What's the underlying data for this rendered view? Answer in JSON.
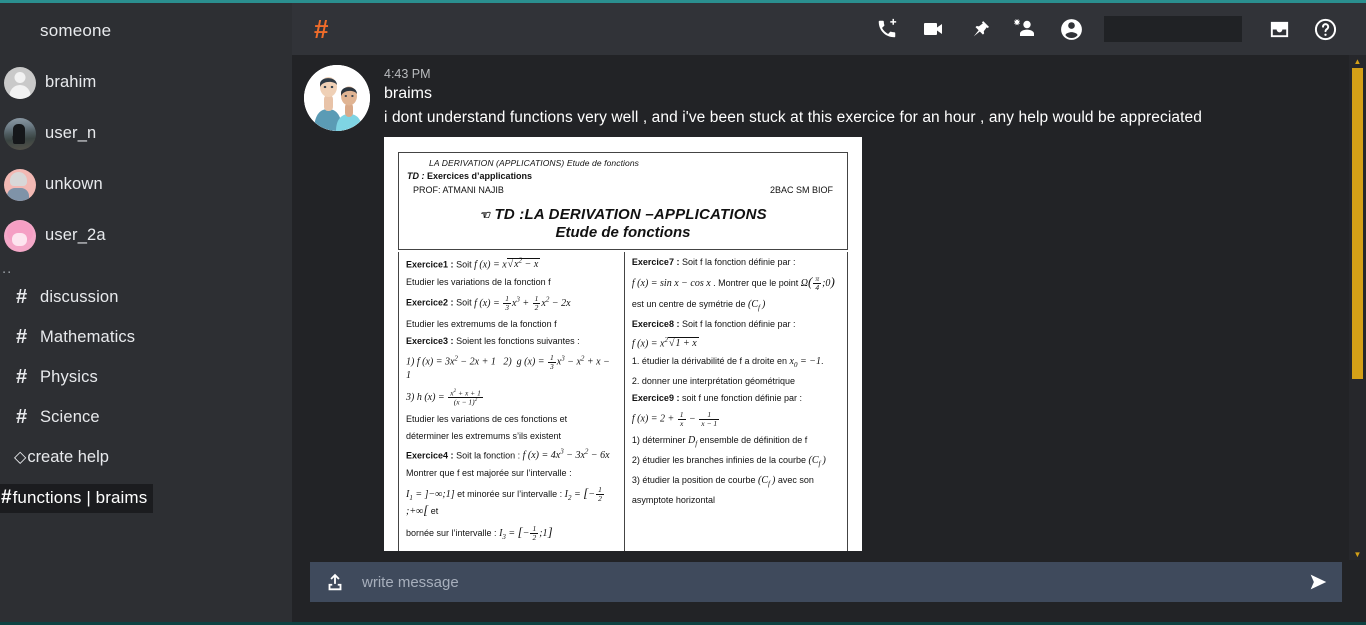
{
  "window": {
    "accent_top": "#2a8f8f",
    "accent_bottom": "#0e4242"
  },
  "sidebar": {
    "title": "someone",
    "dms": [
      {
        "name": "brahim",
        "avatar": "default-person-avatar"
      },
      {
        "name": "user_n",
        "avatar": "photo-avatar-dark"
      },
      {
        "name": "unkown",
        "avatar": "photo-avatar-pink"
      },
      {
        "name": "user_2a",
        "avatar": "photo-avatar-anime"
      }
    ],
    "divider_dots": "..",
    "channels": [
      {
        "hash": "#",
        "name": "discussion"
      },
      {
        "hash": "#",
        "name": "Mathematics"
      },
      {
        "hash": "#",
        "name": "Physics"
      },
      {
        "hash": "#",
        "name": "Science"
      }
    ],
    "create": {
      "icon": "pencil-icon",
      "glyph": "◇",
      "label": "create help"
    },
    "active_channel": {
      "hash": "#",
      "label": "functions | braims"
    }
  },
  "topbar": {
    "hash": "#",
    "hash_color": "#ef6c2a",
    "icons": [
      {
        "name": "add-call-icon",
        "label": "Add call"
      },
      {
        "name": "video-call-icon",
        "label": "Video call"
      },
      {
        "name": "pin-icon",
        "label": "Pinned messages"
      },
      {
        "name": "add-person-icon",
        "label": "Add member"
      },
      {
        "name": "account-circle-icon",
        "label": "Account"
      }
    ],
    "search": {
      "value": "",
      "placeholder": ""
    },
    "right_icons": [
      {
        "name": "inbox-icon",
        "label": "Inbox"
      },
      {
        "name": "help-icon",
        "label": "Help"
      }
    ]
  },
  "message": {
    "time": "4:43 PM",
    "author": "braims",
    "avatar": "couple-photo-avatar",
    "text": "i dont understand functions very well , and i've been stuck at this exercice for an hour , any help would be appreciated",
    "attachment": {
      "name": "derivation-worksheet-image",
      "doc": {
        "header_line1": "LA DERIVATION (APPLICATIONS)  Etude de fonctions",
        "header_line2_bold_italic": "TD :",
        "header_line2": "Exercices d’applications",
        "prof": "PROF: ATMANI NAJIB",
        "class": "2BAC SM BIOF",
        "title": "TD :LA DERIVATION –APPLICATIONS",
        "subtitle": "Etude de fonctions",
        "left_column": {
          "ex1_label": "Exercice1 :",
          "ex1_text": "Soit",
          "ex1_instr": "Etudier les variations de la fonction f",
          "ex2_label": "Exercice2 :",
          "ex2_text": "Soit",
          "ex2_instr": "Etudier les extremums de la fonction f",
          "ex3_label": "Exercice3 :",
          "ex3_text": "Soient les fonctions suivantes :",
          "ex3_instr_a": "Etudier les variations de ces fonctions et",
          "ex3_instr_b": "déterminer les extremums s’ils existent",
          "ex4_label": "Exercice4 :",
          "ex4_text": "Soit la fonction :",
          "ex4_instr": "Montrer que f est majorée sur l’intervalle :",
          "ex4_mid": "et minorée sur l’intervalle :",
          "ex4_and": "et",
          "ex4_end": "bornée sur l’intervalle :"
        },
        "right_column": {
          "ex7_label": "Exercice7 :",
          "ex7_text": "Soit f la fonction définie par :",
          "ex7_mid": ". Montrer que le point",
          "ex7_instr": "est un centre de symétrie  de",
          "ex8_label": "Exercice8 :",
          "ex8_text": "Soit f la fonction définie par :",
          "ex8_q1": "1. étudier la dérivabilité de f a droite en",
          "ex8_q2": "2. donner une interprétation géométrique",
          "ex9_label": "Exercice9 :",
          "ex9_text": "soit f  une fonction définie par :",
          "ex9_q1a": "1) déterminer",
          "ex9_q1b": "ensemble de définition de  f",
          "ex9_q2": "2) étudier les branches infinies de la courbe",
          "ex9_q3": "3) étudier la position de courbe",
          "ex9_q3b": "avec son",
          "ex9_q3c": "asymptote horizontal"
        }
      }
    }
  },
  "composer": {
    "upload_icon": "upload-icon",
    "placeholder": "write message",
    "value": "",
    "send_icon": "send-icon"
  },
  "scrollbar": {
    "color": "#d4a017",
    "up_glyph": "▲",
    "down_glyph": "▼"
  }
}
